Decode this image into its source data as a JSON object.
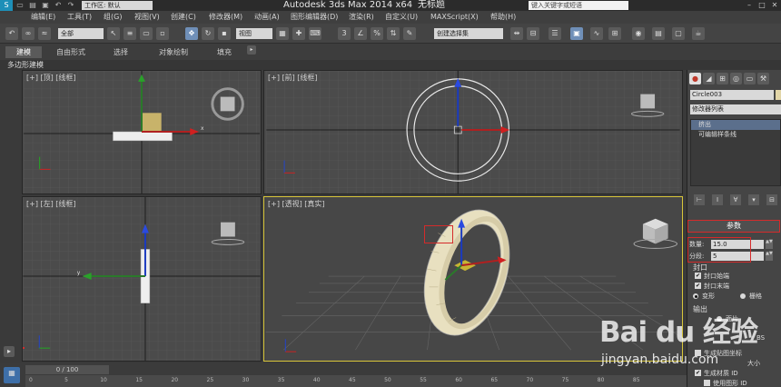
{
  "titlebar": {
    "workspace": "工作区: 默认",
    "app_title": "Autodesk 3ds Max  2014 x64",
    "doc_title": "无标题",
    "search_placeholder": "键入关键字或短语",
    "minimize": "–",
    "restore": "□",
    "close": "✕"
  },
  "menu": {
    "items": [
      "编辑(E)",
      "工具(T)",
      "组(G)",
      "视图(V)",
      "创建(C)",
      "修改器(M)",
      "动画(A)",
      "图形编辑器(D)",
      "渲染(R)",
      "自定义(U)",
      "MAXScript(X)",
      "帮助(H)"
    ]
  },
  "toolbar": {
    "filter": "全部",
    "ref_coord": "视图",
    "snap_num": "3",
    "selection_set": "创建选择集"
  },
  "ribbon": {
    "tabs": [
      "建模",
      "自由形式",
      "选择",
      "对象绘制",
      "填充"
    ],
    "sub_label": "多边形建模"
  },
  "viewports": {
    "top": "[+] [顶] [线框]",
    "front": "[+] [前] [线框]",
    "left": "[+] [左] [线框]",
    "perspective": "[+] [透视] [真实]"
  },
  "cmdpanel": {
    "object_name": "Circle003",
    "modifier_list": "修改器列表",
    "stack": [
      "挤出",
      "可编辑样条线"
    ],
    "params_title": "参数",
    "amount_label": "数量:",
    "amount_value": "15.0",
    "segments_label": "分段:",
    "segments_value": "5",
    "capping_label": "封口",
    "cap_start": "封口始端",
    "cap_end": "封口末端",
    "morph": "变形",
    "grid": "栅格",
    "output_label": "输出",
    "patch": "面片",
    "gen_map_coords": "生成贴图坐标",
    "gen_mat_ids": "生成材质 ID",
    "use_shape_ids": "使用图形 ID",
    "real_world": "大小",
    "nurbs_tail": "BS",
    "colors": {
      "accent": "#d42b2b",
      "active_viewport": "#d8c63a",
      "object": "#e2d6a8"
    }
  },
  "timeline": {
    "slider": "0 / 100",
    "ticks": [
      "0",
      "5",
      "10",
      "15",
      "20",
      "25",
      "30",
      "35",
      "40",
      "45",
      "50",
      "55",
      "60",
      "65",
      "70",
      "75",
      "80",
      "85"
    ]
  },
  "watermark": {
    "text": "Bai du 经验",
    "url": "jingyan.baidu.com"
  }
}
